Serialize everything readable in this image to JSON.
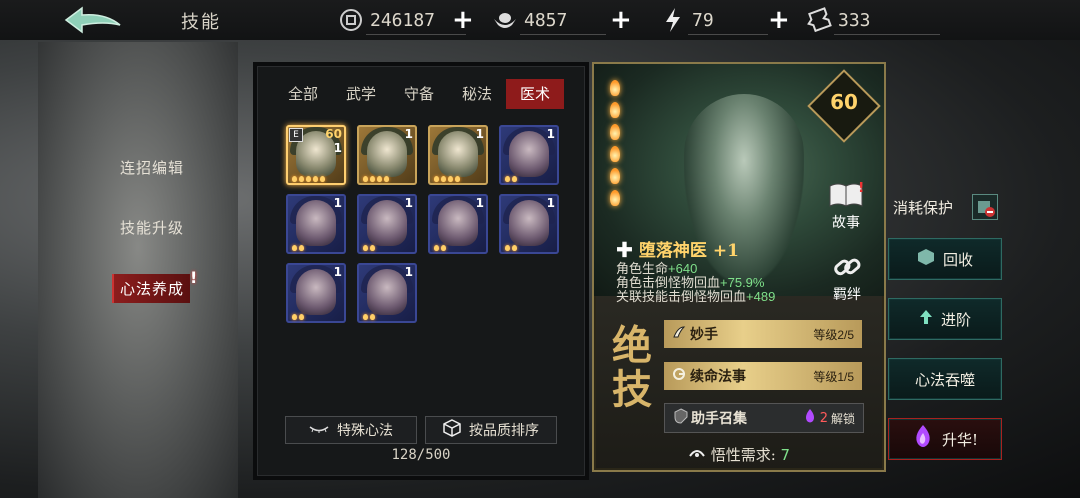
{
  "header": {
    "title": "技能",
    "resources": [
      {
        "icon": "coin-icon",
        "value": "246187"
      },
      {
        "icon": "silver-ingot-icon",
        "value": "4857"
      },
      {
        "icon": "lightning-icon",
        "value": "79"
      },
      {
        "icon": "ticket-icon",
        "value": "333"
      }
    ],
    "plus": "+"
  },
  "sidebar": {
    "items": [
      {
        "label": "连招编辑"
      },
      {
        "label": "技能升级"
      },
      {
        "label": "心法养成"
      }
    ],
    "alert": "!"
  },
  "inventory": {
    "tabs": [
      "全部",
      "武学",
      "守备",
      "秘法",
      "医术"
    ],
    "active_tab": "医术",
    "items": [
      {
        "style": "gold",
        "tag": "E",
        "level": "60",
        "count": "1",
        "stars": 5
      },
      {
        "style": "gold",
        "count": "1",
        "stars": 4
      },
      {
        "style": "gold",
        "count": "1",
        "stars": 4
      },
      {
        "style": "blue",
        "count": "1",
        "stars": 2
      },
      {
        "style": "blue",
        "count": "1",
        "stars": 2
      },
      {
        "style": "blue",
        "count": "1",
        "stars": 2
      },
      {
        "style": "blue",
        "count": "1",
        "stars": 2
      },
      {
        "style": "blue",
        "count": "1",
        "stars": 2
      },
      {
        "style": "blue",
        "count": "1",
        "stars": 2
      },
      {
        "style": "blue",
        "count": "1",
        "stars": 2
      }
    ],
    "special_label": "特殊心法",
    "sort_label": "按品质排序",
    "capacity": "128/500"
  },
  "detail": {
    "level": "60",
    "name": "堕落神医 +1",
    "story": "故事",
    "bond": "羁绊",
    "stats": [
      {
        "label": "角色生命",
        "value": "+640"
      },
      {
        "label": "角色击倒怪物回血",
        "value": "+75.9%"
      },
      {
        "label": "关联技能击倒怪物回血",
        "value": "+489"
      }
    ],
    "ultimate": "绝技",
    "skills": [
      {
        "name": "妙手",
        "level": "等级2/5"
      },
      {
        "name": "续命法事",
        "level": "等级1/5"
      },
      {
        "name": "助手召集",
        "unlock_count": "2",
        "unlock_label": "解锁"
      }
    ],
    "requirement_label": "悟性需求:",
    "requirement_value": "7"
  },
  "right": {
    "protection_label": "消耗保护",
    "recycle": "回收",
    "advance": "进阶",
    "devour": "心法吞噬",
    "ascend": "升华!"
  },
  "colors": {
    "accent_red": "#8e1b1b",
    "gold": "#ffd36b",
    "teal": "#2e6a62",
    "green": "#7fe08a"
  }
}
